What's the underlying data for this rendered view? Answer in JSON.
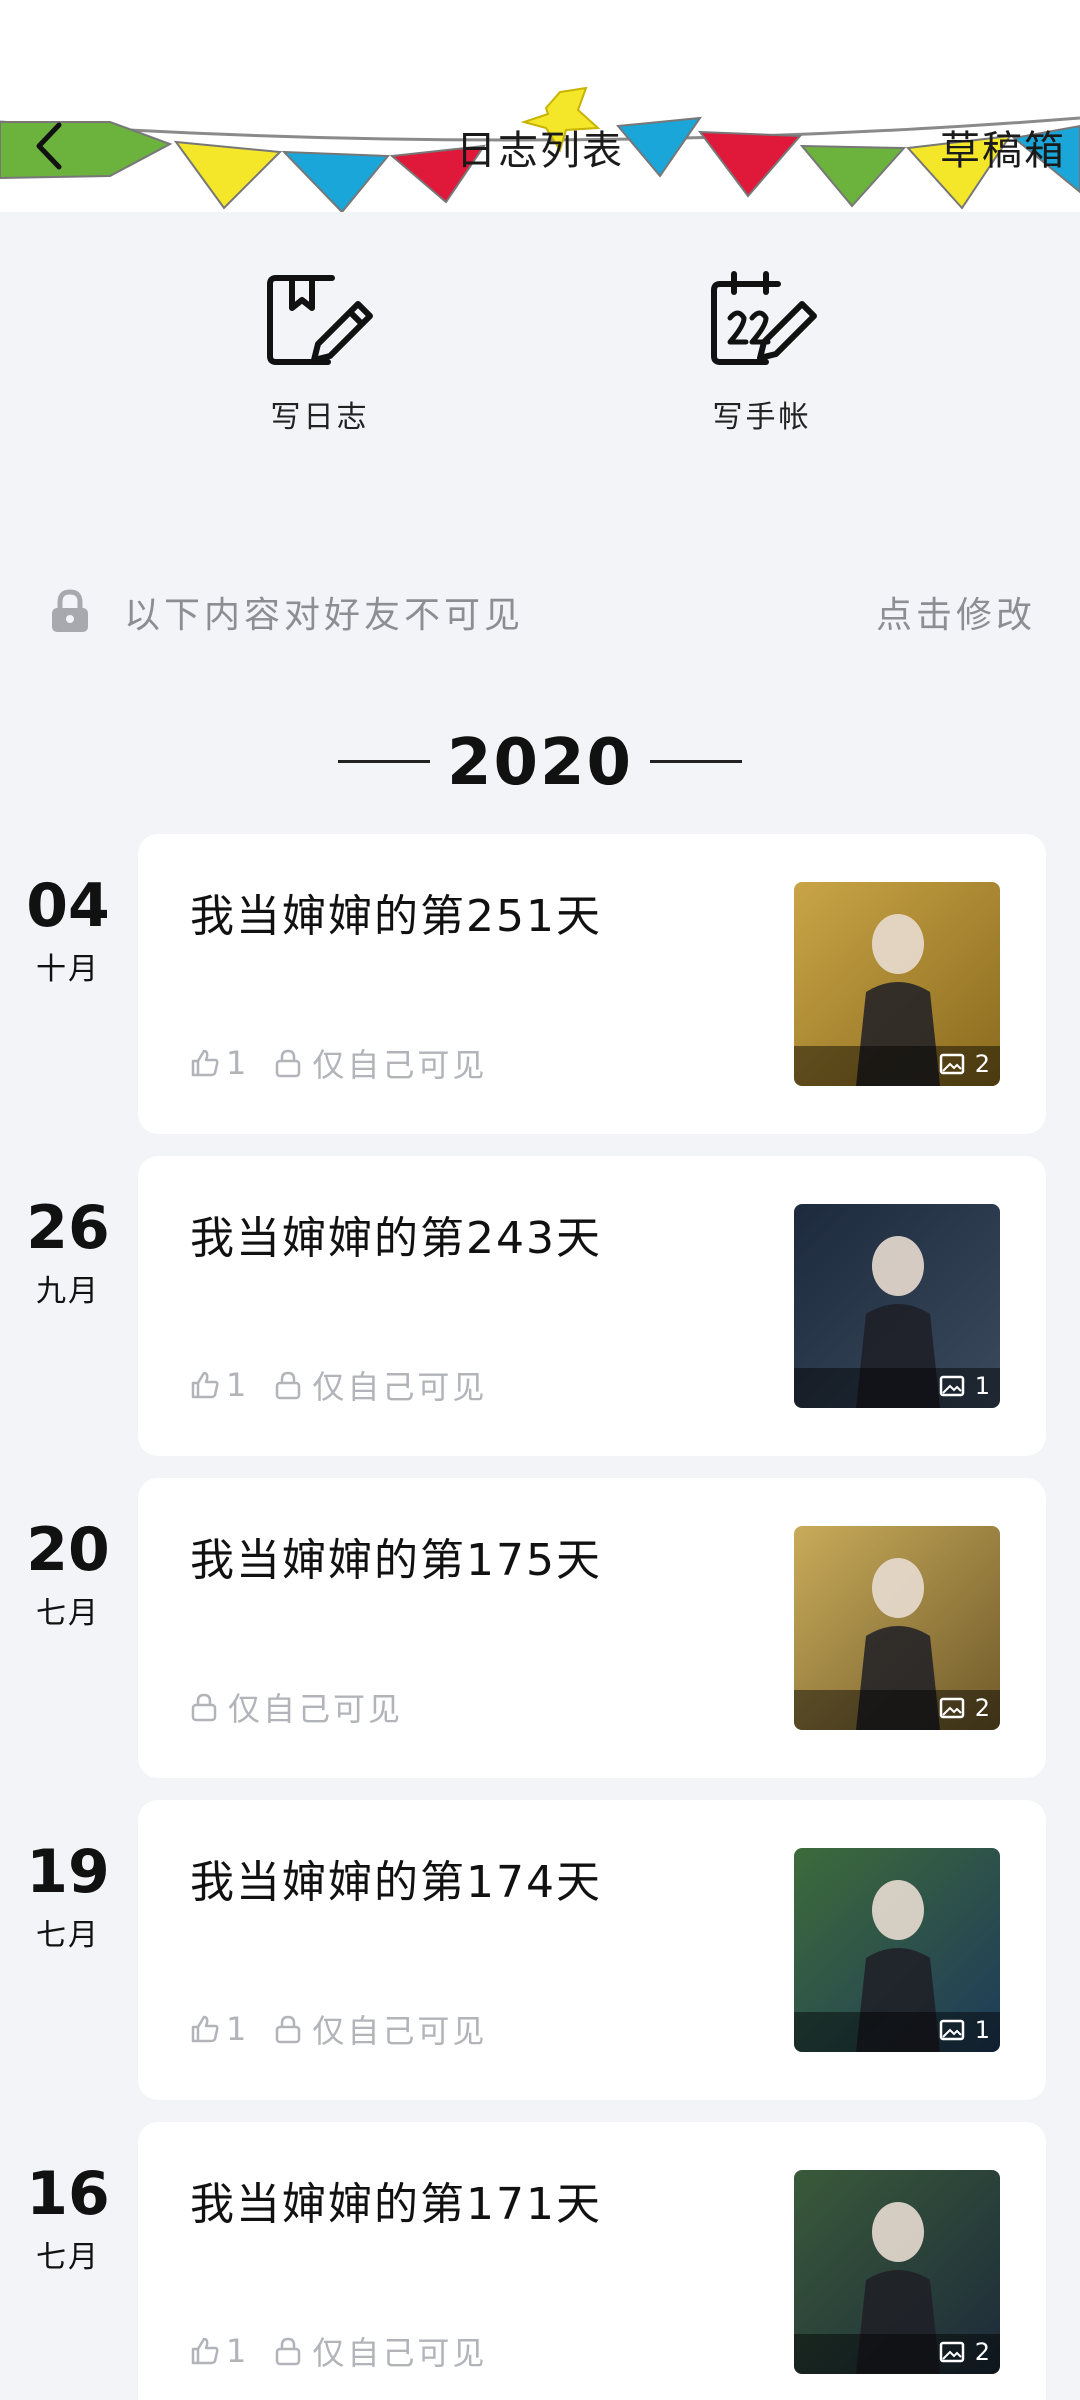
{
  "header": {
    "title": "日志列表",
    "drafts_label": "草稿箱",
    "back_icon": "chevron-left-icon"
  },
  "actions": [
    {
      "label": "写日志",
      "icon": "journal-edit-icon"
    },
    {
      "label": "写手帐",
      "icon": "calendar-edit-icon"
    }
  ],
  "privacy": {
    "text": "以下内容对好友不可见",
    "edit_label": "点击修改",
    "icon": "lock-icon"
  },
  "year": "2020",
  "entries": [
    {
      "day": "04",
      "month": "十月",
      "title": "我当婶婶的第251天",
      "likes": "1",
      "visibility": "仅自己可见",
      "photo_count": "2",
      "palette": [
        "#c9a547",
        "#8a6a1e"
      ]
    },
    {
      "day": "26",
      "month": "九月",
      "title": "我当婶婶的第243天",
      "likes": "1",
      "visibility": "仅自己可见",
      "photo_count": "1",
      "palette": [
        "#1d2a3e",
        "#3a4a5c"
      ]
    },
    {
      "day": "20",
      "month": "七月",
      "title": "我当婶婶的第175天",
      "likes": "",
      "visibility": "仅自己可见",
      "photo_count": "2",
      "palette": [
        "#c9ab5a",
        "#6f5a2a"
      ]
    },
    {
      "day": "19",
      "month": "七月",
      "title": "我当婶婶的第174天",
      "likes": "1",
      "visibility": "仅自己可见",
      "photo_count": "1",
      "palette": [
        "#3d6b3a",
        "#1e3a5a"
      ]
    },
    {
      "day": "16",
      "month": "七月",
      "title": "我当婶婶的第171天",
      "likes": "1",
      "visibility": "仅自己可见",
      "photo_count": "2",
      "palette": [
        "#3a5a3a",
        "#1c2a3a"
      ]
    }
  ],
  "colors": {
    "background": "#f3f4f8",
    "card": "#ffffff",
    "muted_text": "#b2b4ba",
    "flag_green": "#6cb33e",
    "flag_yellow": "#f4e629",
    "flag_blue": "#1aa6d8",
    "flag_red": "#e0183a"
  }
}
